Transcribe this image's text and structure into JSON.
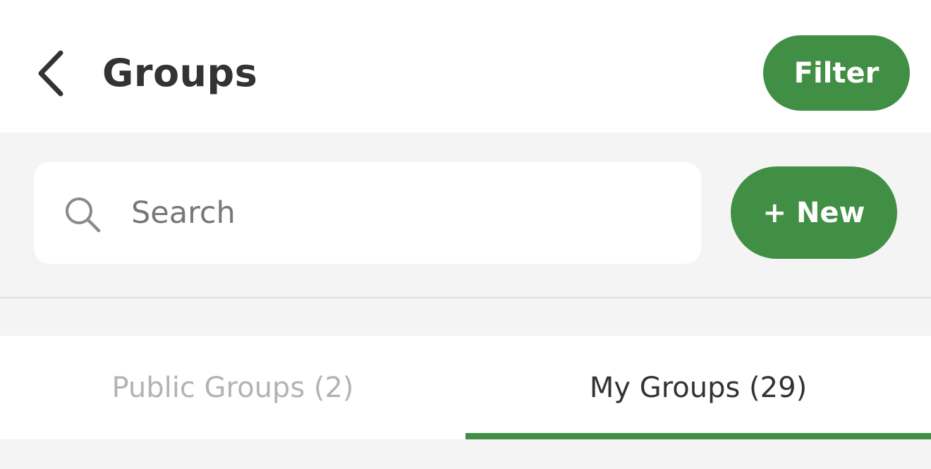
{
  "header": {
    "back_icon": "chevron-left-icon",
    "title": "Groups",
    "filter_label": "Filter"
  },
  "search": {
    "icon": "search-icon",
    "placeholder": "Search",
    "value": ""
  },
  "actions": {
    "new_label": "+ New"
  },
  "tabs": [
    {
      "label": "Public Groups (2)",
      "active": false
    },
    {
      "label": "My Groups (29)",
      "active": true
    }
  ],
  "colors": {
    "accent": "#418f45",
    "title_text": "#333333",
    "inactive_tab_text": "#b3b3b3",
    "background": "#f4f4f4"
  }
}
